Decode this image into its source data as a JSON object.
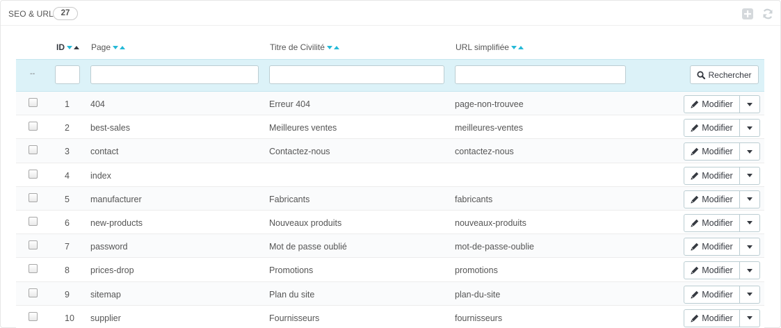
{
  "panel": {
    "title": "SEO & URL",
    "count": "27"
  },
  "columns": {
    "id": "ID",
    "page": "Page",
    "titre": "Titre de Civilité",
    "url": "URL simplifiée"
  },
  "filters": {
    "dash": "--",
    "id_value": "",
    "page_value": "",
    "titre_value": "",
    "url_value": "",
    "search_label": "Rechercher"
  },
  "row_action": {
    "edit_label": "Modifier"
  },
  "rows": [
    {
      "id": "1",
      "page": "404",
      "titre": "Erreur 404",
      "url": "page-non-trouvee"
    },
    {
      "id": "2",
      "page": "best-sales",
      "titre": "Meilleures ventes",
      "url": "meilleures-ventes"
    },
    {
      "id": "3",
      "page": "contact",
      "titre": "Contactez-nous",
      "url": "contactez-nous"
    },
    {
      "id": "4",
      "page": "index",
      "titre": "",
      "url": ""
    },
    {
      "id": "5",
      "page": "manufacturer",
      "titre": "Fabricants",
      "url": "fabricants"
    },
    {
      "id": "6",
      "page": "new-products",
      "titre": "Nouveaux produits",
      "url": "nouveaux-produits"
    },
    {
      "id": "7",
      "page": "password",
      "titre": "Mot de passe oublié",
      "url": "mot-de-passe-oublie"
    },
    {
      "id": "8",
      "page": "prices-drop",
      "titre": "Promotions",
      "url": "promotions"
    },
    {
      "id": "9",
      "page": "sitemap",
      "titre": "Plan du site",
      "url": "plan-du-site"
    },
    {
      "id": "10",
      "page": "supplier",
      "titre": "Fournisseurs",
      "url": "fournisseurs"
    }
  ],
  "icons": {
    "add": "add-icon",
    "refresh": "refresh-icon",
    "search": "search-icon",
    "edit": "pencil-icon",
    "dropdown": "caret-down-icon"
  },
  "colors": {
    "accent": "#25b9d7",
    "filter_bg": "#dcf2f8",
    "text": "#555555"
  }
}
